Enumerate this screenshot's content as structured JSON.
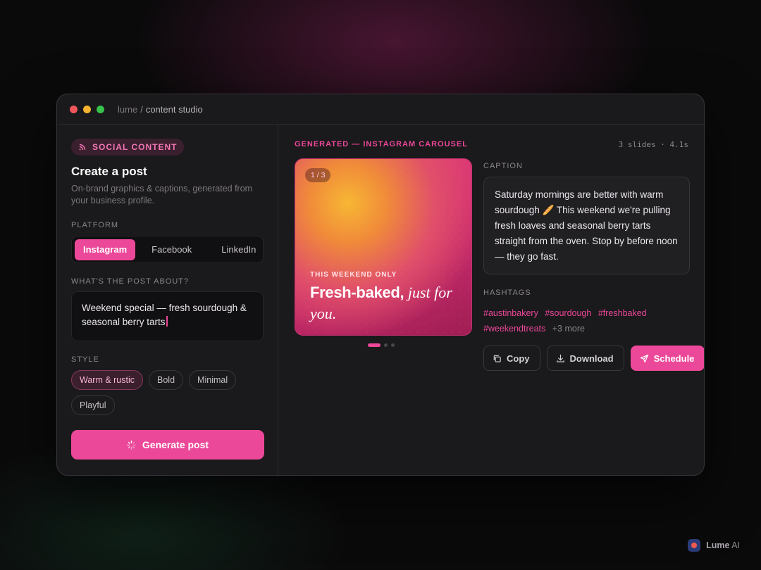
{
  "window": {
    "app": "lume",
    "separator": "/",
    "page": "content studio"
  },
  "left": {
    "badge": "SOCIAL CONTENT",
    "title": "Create a post",
    "subtitle": "On-brand graphics & captions, generated from your business profile.",
    "platform_label": "PLATFORM",
    "platforms": [
      "Instagram",
      "Facebook",
      "LinkedIn"
    ],
    "selected_platform": "Instagram",
    "prompt_label": "WHAT'S THE POST ABOUT?",
    "prompt_value": "Weekend special — fresh sourdough & seasonal berry tarts",
    "style_label": "STYLE",
    "styles": [
      "Warm & rustic",
      "Bold",
      "Minimal",
      "Playful"
    ],
    "selected_style": "Warm & rustic",
    "generate_label": "Generate post"
  },
  "right": {
    "generated_label": "GENERATED — INSTAGRAM CAROUSEL",
    "meta": "3 slides · 4.1s",
    "slide": {
      "counter": "1 / 3",
      "kicker": "THIS WEEKEND ONLY",
      "headline_sans": "Fresh-baked,",
      "headline_serif": " just for you."
    },
    "pager": {
      "total": 3,
      "current": 1
    },
    "caption_label": "CAPTION",
    "caption": "Saturday mornings are better with warm sourdough 🥖 This weekend we're pulling fresh loaves and seasonal berry tarts straight from the oven. Stop by before noon — they go fast.",
    "hashtags_label": "HASHTAGS",
    "hashtags": [
      "#austinbakery",
      "#sourdough",
      "#freshbaked",
      "#weekendtreats"
    ],
    "hashtags_more": "+3 more",
    "actions": {
      "copy": "Copy",
      "download": "Download",
      "schedule": "Schedule"
    }
  },
  "brand": {
    "bold": "Lume",
    "rest": " AI"
  },
  "colors": {
    "accent": "#ec4899",
    "window_bg": "#1a191b",
    "page_bg": "#0b0a0b"
  }
}
